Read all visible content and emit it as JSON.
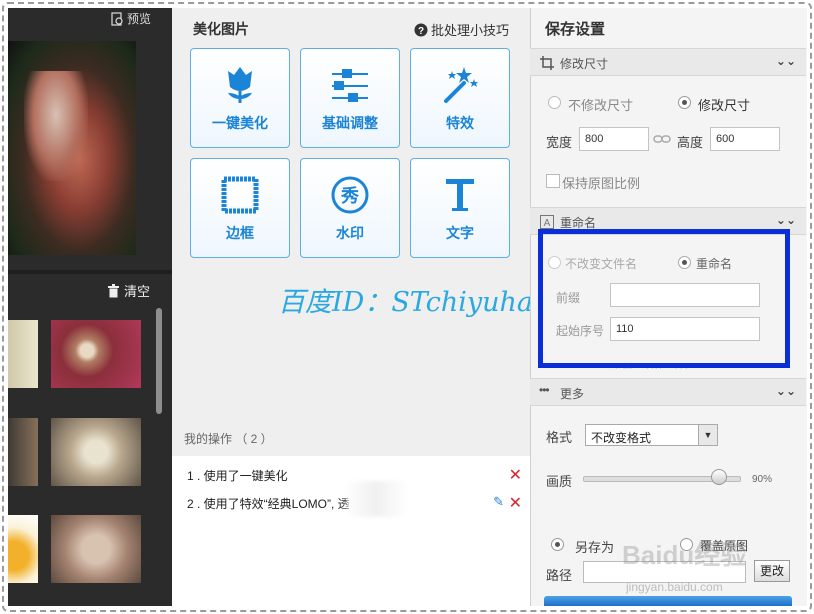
{
  "left": {
    "preview_label": "预览",
    "clear_label": "清空"
  },
  "beautify": {
    "title": "美化图片",
    "tips_label": "批处理小技巧",
    "tiles": [
      {
        "label": "一键美化",
        "icon": "tulip-icon"
      },
      {
        "label": "基础调整",
        "icon": "sliders-icon"
      },
      {
        "label": "特效",
        "icon": "magic-wand-icon"
      },
      {
        "label": "边框",
        "icon": "frame-icon"
      },
      {
        "label": "水印",
        "icon": "watermark-icon"
      },
      {
        "label": "文字",
        "icon": "text-icon"
      }
    ]
  },
  "watermark_text": "百度ID：STchiyuhai",
  "operations": {
    "title": "我的操作 （ 2 ）",
    "items": [
      {
        "text": "1 . 使用了一键美化"
      },
      {
        "text": "2 . 使用了特效“经典LOMO”, 透"
      }
    ]
  },
  "save": {
    "title": "保存设置",
    "resize": {
      "header": "修改尺寸",
      "opt_keep": "不修改尺寸",
      "opt_change": "修改尺寸",
      "width_label": "宽度",
      "width_value": "800",
      "height_label": "高度",
      "height_value": "600",
      "keep_ratio": "保持原图比例"
    },
    "rename": {
      "header": "重命名",
      "opt_keep": "不改变文件名",
      "opt_rename": "重命名",
      "prefix_label": "前缀",
      "prefix_value": "",
      "start_label": "起始序号",
      "start_value": "110",
      "example": "示例：110，111..."
    },
    "more": {
      "header": "更多",
      "format_label": "格式",
      "format_value": "不改变格式",
      "quality_label": "画质",
      "quality_value": "90%",
      "quality_fraction": 0.9,
      "save_as": "另存为",
      "overwrite": "覆盖原图",
      "path_label": "路径",
      "change_label": "更改"
    }
  },
  "overlay": {
    "brand": "Baidu经验",
    "url": "jingyan.baidu.com"
  },
  "colors": {
    "accent_blue": "#1c84d6",
    "highlight_box": "#0b2fd6",
    "watermark_cyan": "#2aa8e0",
    "delete_red": "#d9262c"
  }
}
